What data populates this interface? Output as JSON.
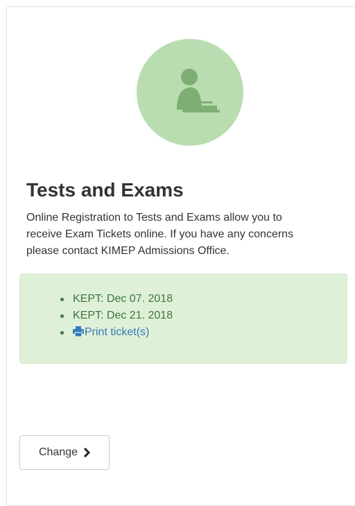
{
  "card": {
    "title": "Tests and Exams",
    "description_lines": [
      "Online Registration to Tests and Exams allow you to",
      "receive Exam Tickets online. If you have any concerns",
      "please contact KIMEP Admissions Office."
    ],
    "avatar_icon": "person-at-desk-icon"
  },
  "panel": {
    "items": [
      "KEPT: Dec 07. 2018",
      "KEPT: Dec 21. 2018"
    ],
    "print_link_label": "Print ticket(s)",
    "print_icon": "printer-icon"
  },
  "actions": {
    "change_label": "Change",
    "change_icon": "chevron-right-icon"
  },
  "colors": {
    "avatar_bg": "#b9ddb0",
    "panel_bg": "#dff0d8",
    "panel_text": "#3c763d",
    "link": "#337ab7"
  }
}
